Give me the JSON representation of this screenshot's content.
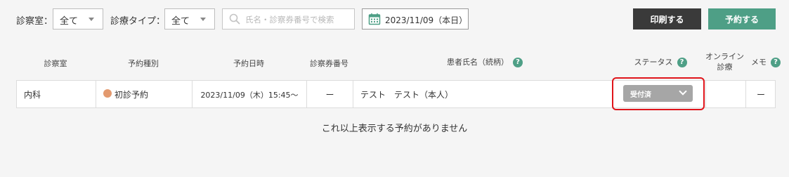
{
  "filters": {
    "room_label": "診察室：",
    "room_value": "全て",
    "type_label": "診療タイプ：",
    "type_value": "全て",
    "search_placeholder": "氏名・診察券番号で検索",
    "date_value": "2023/11/09（本日）"
  },
  "buttons": {
    "print": "印刷する",
    "reserve": "予約する"
  },
  "table": {
    "columns": {
      "room": "診察室",
      "reservation_type": "予約種別",
      "datetime": "予約日時",
      "card_number": "診察券番号",
      "patient_name": "患者氏名（続柄）",
      "status": "ステータス",
      "online_line1": "オンライン",
      "online_line2": "診療",
      "memo": "メモ"
    },
    "help_mark": "?",
    "rows": [
      {
        "room": "内科",
        "reservation_type": "初診予約",
        "datetime": "2023/11/09（木）15:45～",
        "card_number": "ー",
        "patient_name": "テスト　テスト（本人）",
        "status": "受付済",
        "online": "",
        "memo": "ー"
      }
    ],
    "empty_message": "これ以上表示する予約がありません"
  },
  "colors": {
    "accent": "#4e9f86",
    "print_button": "#3a3a3a",
    "status_badge": "#a6a6a6",
    "first_visit_dot": "#e39a6f",
    "highlight": "#e0151b"
  },
  "icons": {
    "search": "magnifier-icon",
    "calendar": "calendar-icon"
  }
}
